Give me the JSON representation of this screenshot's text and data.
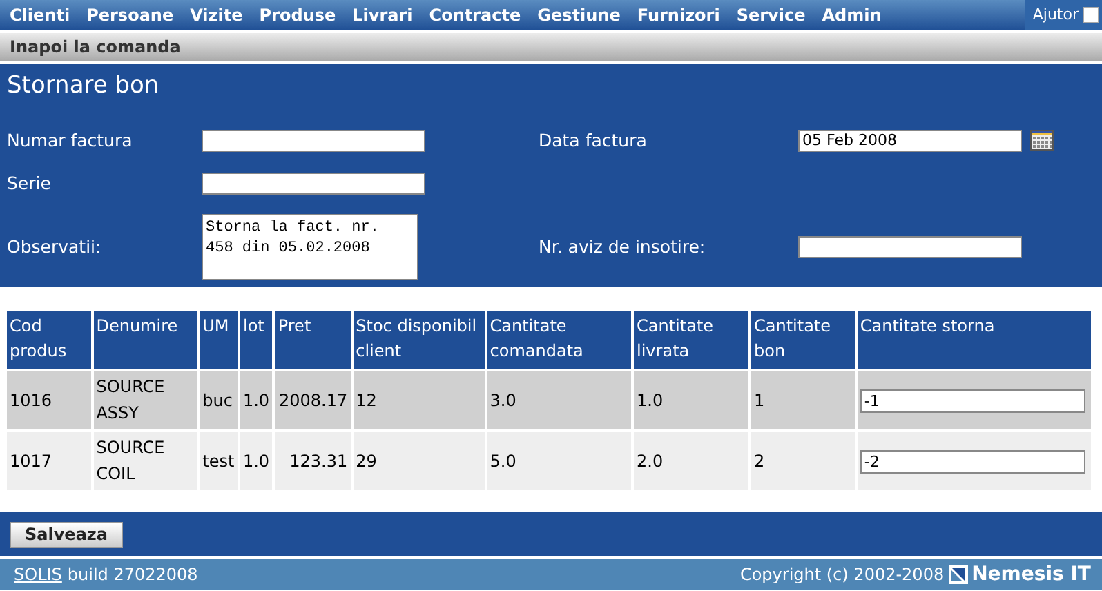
{
  "menu": {
    "items": [
      "Clienti",
      "Persoane",
      "Vizite",
      "Produse",
      "Livrari",
      "Contracte",
      "Gestiune",
      "Furnizori",
      "Service",
      "Admin"
    ],
    "help": {
      "label": "Ajutor",
      "checked": false
    }
  },
  "subbar": {
    "link": "Inapoi la comanda"
  },
  "form": {
    "title": "Stornare bon",
    "rows": [
      [
        {
          "label": "Numar factura",
          "kind": "input"
        },
        {
          "label": "Data factura",
          "value": "05 Feb 2008",
          "kind": "date"
        }
      ],
      [
        {
          "label": "Serie",
          "kind": "input"
        }
      ],
      [
        {
          "label": "Observatii:",
          "value": "Storna la fact. nr. 458 din 05.02.2008",
          "kind": "textarea"
        },
        {
          "label": "Nr. aviz de insotire:",
          "kind": "input"
        }
      ]
    ]
  },
  "table": {
    "columns": [
      "Cod produs",
      "Denumire",
      "UM",
      "lot",
      "Pret",
      "Stoc disponibil client",
      "Cantitate comandata",
      "Cantitate livrata",
      "Cantitate bon",
      "Cantitate storna"
    ],
    "rows": [
      {
        "cells": [
          "1016",
          "SOURCE ASSY",
          "buc",
          "1.0",
          "2008.17",
          "12",
          "3.0",
          "1.0",
          "1"
        ],
        "storna": "-1"
      },
      {
        "cells": [
          "1017",
          "SOURCE COIL",
          "test",
          "1.0",
          "123.31",
          "29",
          "5.0",
          "2.0",
          "2"
        ],
        "storna": "-2"
      }
    ]
  },
  "actions": {
    "save": "Salveaza"
  },
  "footer": {
    "link": "SOLIS",
    "build": "build 27022008",
    "copyright": "Copyright (c) 2002-2008",
    "brand": "Nemesis IT"
  }
}
